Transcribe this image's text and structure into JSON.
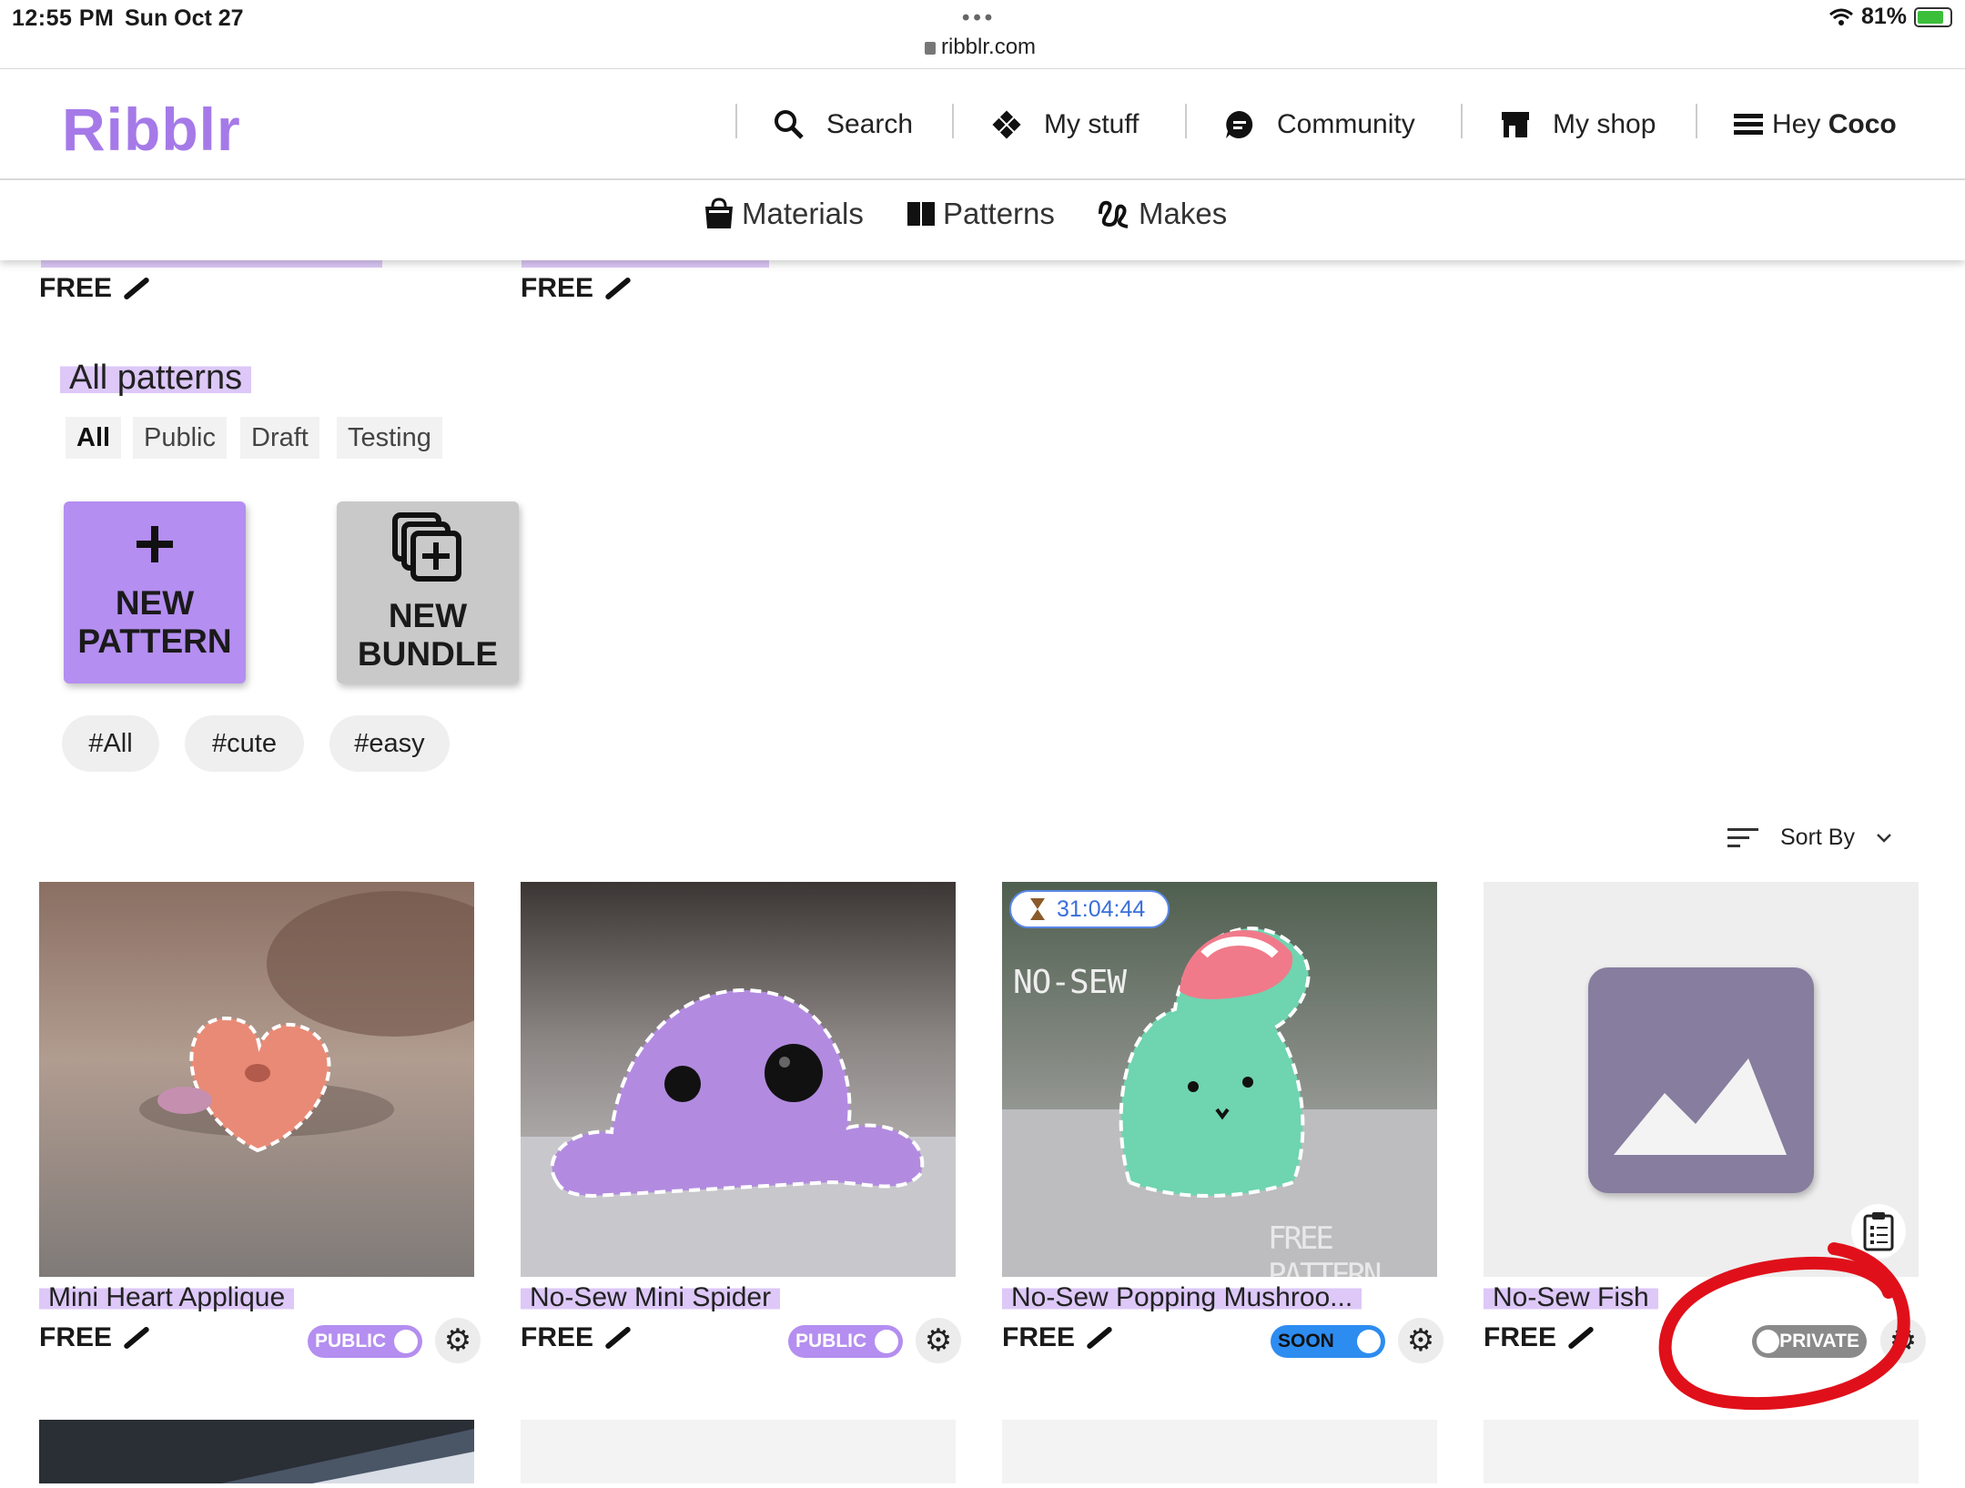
{
  "status": {
    "time": "12:55 PM",
    "date": "Sun Oct 27",
    "url": "ribblr.com",
    "battery": "81%",
    "battery_level": 0.81
  },
  "header": {
    "logo": "Ribblr",
    "nav": [
      {
        "label": "Search",
        "icon": "search-icon"
      },
      {
        "label": "My stuff",
        "icon": "diamond-grid-icon"
      },
      {
        "label": "Community",
        "icon": "chat-icon"
      },
      {
        "label": "My shop",
        "icon": "storefront-icon"
      }
    ],
    "greeting": "Hey",
    "user": "Coco"
  },
  "subnav": [
    {
      "label": "Materials",
      "icon": "bag-icon"
    },
    {
      "label": "Patterns",
      "icon": "book-icon"
    },
    {
      "label": "Makes",
      "icon": "yarn-icon"
    }
  ],
  "prev_row": [
    {
      "price": "FREE"
    },
    {
      "price": "FREE"
    }
  ],
  "section_title": "All patterns",
  "filters": [
    "All",
    "Public",
    "Draft",
    "Testing"
  ],
  "actions": {
    "new_pattern": [
      "NEW",
      "PATTERN"
    ],
    "new_bundle": [
      "NEW",
      "BUNDLE"
    ]
  },
  "tags": [
    "#All",
    "#cute",
    "#easy"
  ],
  "sort_label": "Sort By",
  "patterns": [
    {
      "title": "Mini Heart Applique",
      "price": "FREE",
      "status": "PUBLIC"
    },
    {
      "title": "No-Sew Mini Spider",
      "price": "FREE",
      "status": "PUBLIC"
    },
    {
      "title": "No-Sew Popping Mushroo...",
      "price": "FREE",
      "status": "SOON",
      "timer": "31:04:44",
      "image_text_top": "NO-SEW",
      "image_text_bottom": "FREE PATTERN"
    },
    {
      "title": "No-Sew Fish",
      "price": "FREE",
      "status": "PRIVATE"
    }
  ],
  "colors": {
    "brand": "#a57ae8",
    "public_toggle": "#b48ef0",
    "soon_toggle": "#2d8cf0",
    "private_toggle": "#8a8a8a",
    "annotation": "#e0101a"
  }
}
